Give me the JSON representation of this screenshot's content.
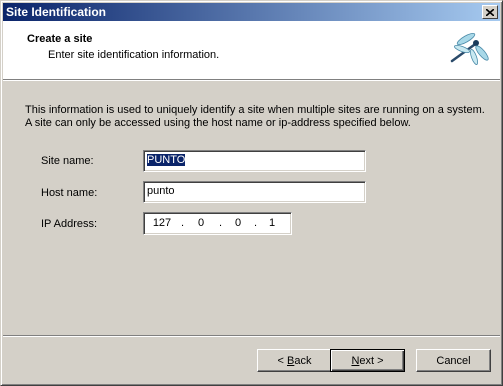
{
  "window": {
    "title": "Site Identification"
  },
  "header": {
    "title": "Create a site",
    "subtitle": "Enter site identification information.",
    "icon": "dragonfly-icon"
  },
  "intro": "This information is used to uniquely identify a site when multiple sites are running on a system. A site can only be accessed using the host name or ip-address specified below.",
  "form": {
    "site_name": {
      "label": "Site name:",
      "value": "PUNTO"
    },
    "host_name": {
      "label": "Host name:",
      "value": "punto"
    },
    "ip_address": {
      "label": "IP Address:",
      "octets": [
        "127",
        "0",
        "0",
        "1"
      ],
      "separator": "."
    }
  },
  "buttons": {
    "back": {
      "prefix": "< ",
      "mnemonic": "B",
      "rest": "ack"
    },
    "next": {
      "mnemonic": "N",
      "rest": "ext >"
    },
    "cancel": {
      "label": "Cancel"
    }
  }
}
